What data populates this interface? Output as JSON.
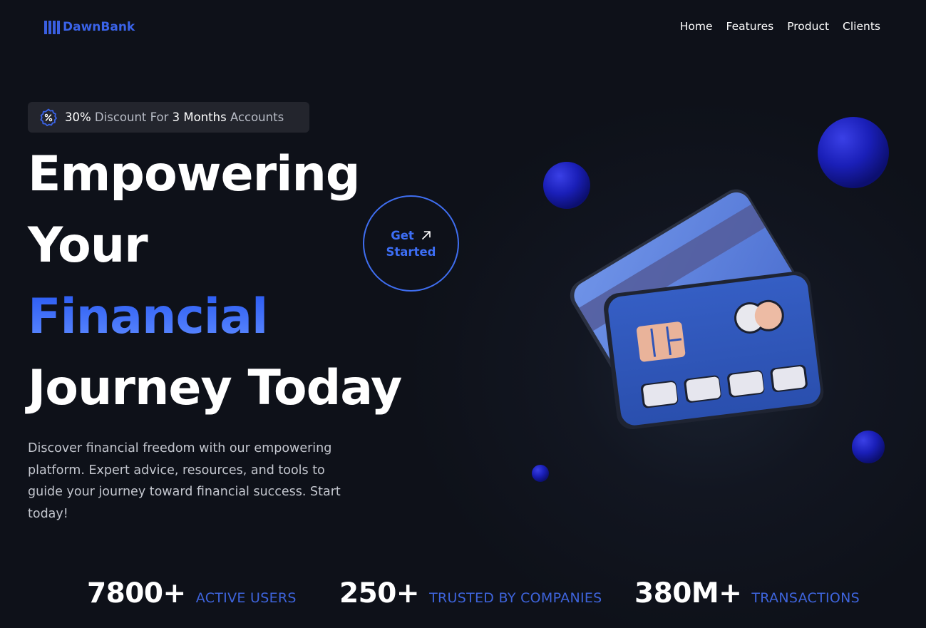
{
  "brand": {
    "name": "DawnBank"
  },
  "nav": {
    "items": [
      "Home",
      "Features",
      "Product",
      "Clients"
    ]
  },
  "promo": {
    "icon": "discount-badge-icon",
    "percent": "30%",
    "text_a": " Discount For ",
    "months": "3 Months",
    "text_b": " Accounts"
  },
  "hero": {
    "line1": "Empowering",
    "line2": "Your",
    "line3": "Financial",
    "line4": "Journey Today",
    "desc": [
      "Discover financial freedom with our empowering",
      "platform. Expert advice, resources, and tools to",
      "guide your journey toward financial success. Start",
      "today!"
    ]
  },
  "cta": {
    "line1": "Get",
    "line2": "Started",
    "icon": "arrow-up-right-icon"
  },
  "stats": [
    {
      "value": "7800+",
      "label": "ACTIVE USERS"
    },
    {
      "value": "250+",
      "label": "TRUSTED BY COMPANIES"
    },
    {
      "value": "380M+",
      "label": "TRANSACTIONS"
    }
  ],
  "colors": {
    "accent": "#3a63e8",
    "card": "#2f55b8",
    "background": "#11141d"
  }
}
